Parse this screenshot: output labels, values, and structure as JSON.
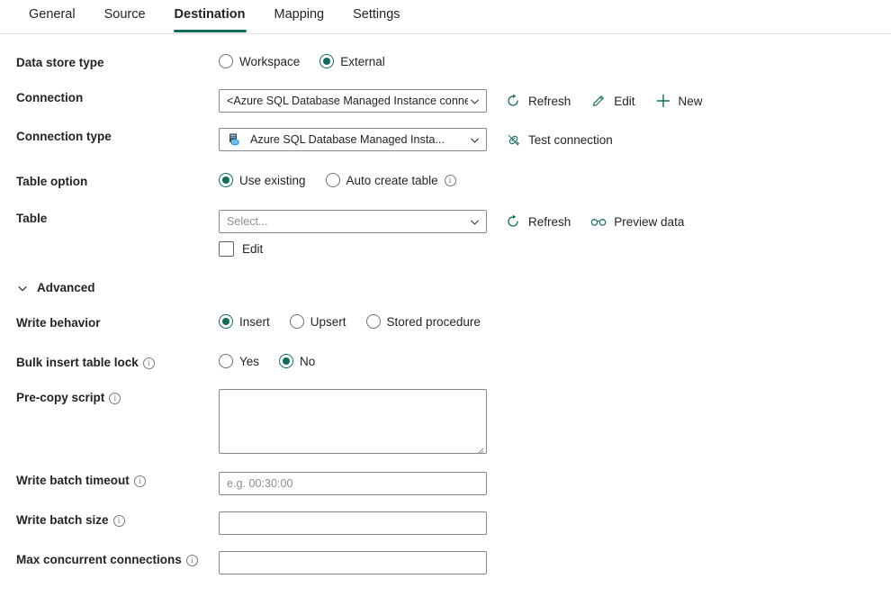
{
  "tabs": [
    {
      "label": "General",
      "active": false
    },
    {
      "label": "Source",
      "active": false
    },
    {
      "label": "Destination",
      "active": true
    },
    {
      "label": "Mapping",
      "active": false
    },
    {
      "label": "Settings",
      "active": false
    }
  ],
  "accent_color": "#0f6c5a",
  "icon_color": "#0f6c5a",
  "form": {
    "data_store_type": {
      "label": "Data store type",
      "options": [
        "Workspace",
        "External"
      ],
      "selected": "External"
    },
    "connection": {
      "label": "Connection",
      "value": "<Azure SQL Database Managed Instance connection>",
      "actions": [
        {
          "label": "Refresh",
          "icon": "refresh-icon"
        },
        {
          "label": "Edit",
          "icon": "pencil-icon"
        },
        {
          "label": "New",
          "icon": "plus-icon"
        }
      ]
    },
    "connection_type": {
      "label": "Connection type",
      "value": "Azure SQL Database Managed Insta...",
      "icon": "azure-sql-database-icon",
      "action": {
        "label": "Test connection",
        "icon": "plug-icon"
      }
    },
    "table_option": {
      "label": "Table option",
      "options": [
        "Use existing",
        "Auto create table"
      ],
      "selected": "Use existing",
      "info_on": "Auto create table"
    },
    "table": {
      "label": "Table",
      "placeholder": "Select...",
      "value": "",
      "edit_checkbox_label": "Edit",
      "edit_checked": false,
      "actions": [
        {
          "label": "Refresh",
          "icon": "refresh-icon"
        },
        {
          "label": "Preview data",
          "icon": "binoculars-icon"
        }
      ]
    },
    "advanced": {
      "label": "Advanced",
      "expanded": true
    },
    "write_behavior": {
      "label": "Write behavior",
      "options": [
        "Insert",
        "Upsert",
        "Stored procedure"
      ],
      "selected": "Insert"
    },
    "bulk_insert_table_lock": {
      "label": "Bulk insert table lock",
      "options": [
        "Yes",
        "No"
      ],
      "selected": "No",
      "has_info": true
    },
    "pre_copy_script": {
      "label": "Pre-copy script",
      "value": "",
      "has_info": true
    },
    "write_batch_timeout": {
      "label": "Write batch timeout",
      "placeholder": "e.g. 00:30:00",
      "value": "",
      "has_info": true
    },
    "write_batch_size": {
      "label": "Write batch size",
      "placeholder": "",
      "value": "",
      "has_info": true
    },
    "max_concurrent_connections": {
      "label": "Max concurrent connections",
      "placeholder": "",
      "value": "",
      "has_info": true
    }
  }
}
